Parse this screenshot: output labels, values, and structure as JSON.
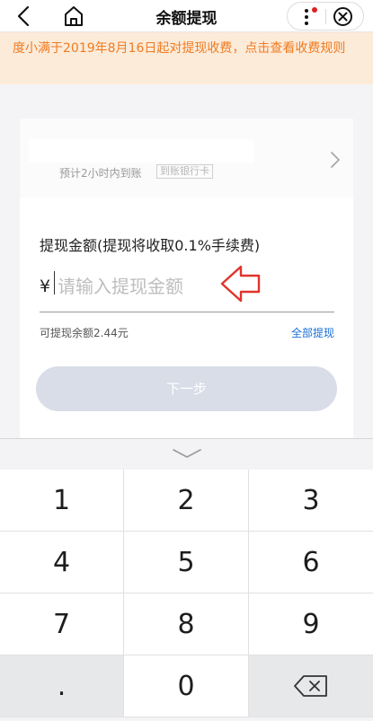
{
  "header": {
    "title": "余额提现",
    "icons": [
      "back-icon",
      "home-icon",
      "more-icon",
      "close-icon"
    ],
    "notification_dot_color": "#e02020"
  },
  "notice": {
    "text": "度小满于2019年8月16日起对提现收费，点击查看收费规则",
    "color": "#f07b22",
    "background": "#fcebd9"
  },
  "bank_card": {
    "arrival_text": "预计2小时内到账",
    "tag": "到账银行卡"
  },
  "withdraw": {
    "label": "提现金额(提现将收取0.1%手续费)",
    "currency": "¥",
    "placeholder": "请输入提现金额",
    "available_balance": "可提现余额2.44元",
    "withdraw_all": "全部提现",
    "next_button": "下一步"
  },
  "keyboard": {
    "keys": [
      "1",
      "2",
      "3",
      "4",
      "5",
      "6",
      "7",
      "8",
      "9",
      ".",
      "0"
    ],
    "delete_icon": "backspace-icon",
    "collapse_icon": "chevron-down-icon"
  },
  "colors": {
    "link": "#1a6fd6",
    "disabled_button": "#d9dde7",
    "annotation_arrow": "#e0342b"
  }
}
